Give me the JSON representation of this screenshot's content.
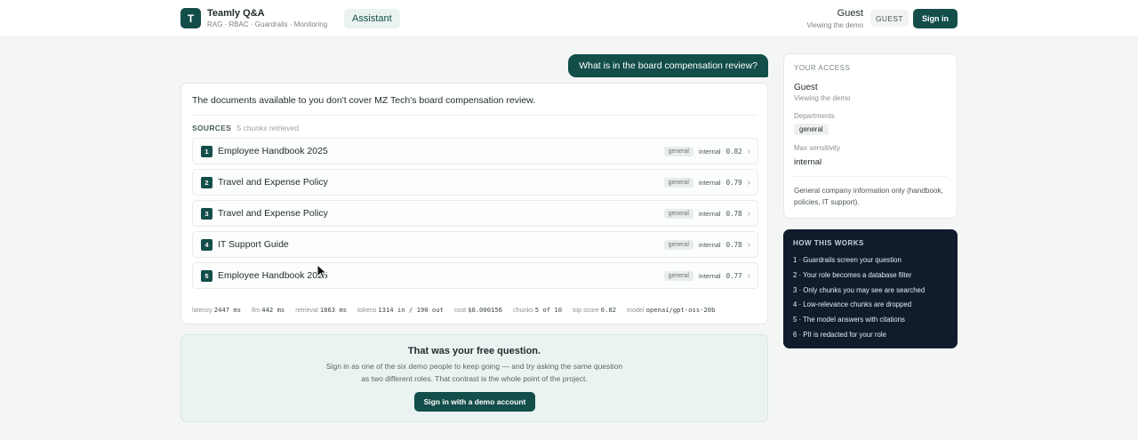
{
  "header": {
    "logo_letter": "T",
    "app_title": "Teamly Q&A",
    "app_subtitle": "RAG · RBAC · Guardrails · Monitoring",
    "nav_tab": "Assistant",
    "user_name": "Guest",
    "user_sub": "Viewing the demo",
    "role_badge": "GUEST",
    "signin_label": "Sign in"
  },
  "chat": {
    "question": "What is in the board compensation review?",
    "answer": "The documents available to you don't cover MZ Tech's board compensation review.",
    "sources_label": "SOURCES",
    "sources_count": "5 chunks retrieved",
    "sources": [
      {
        "num": "1",
        "title": "Employee Handbook 2025",
        "dept": "general",
        "sensitivity": "internal",
        "score": "0.82"
      },
      {
        "num": "2",
        "title": "Travel and Expense Policy",
        "dept": "general",
        "sensitivity": "internal",
        "score": "0.79"
      },
      {
        "num": "3",
        "title": "Travel and Expense Policy",
        "dept": "general",
        "sensitivity": "internal",
        "score": "0.78"
      },
      {
        "num": "4",
        "title": "IT Support Guide",
        "dept": "general",
        "sensitivity": "internal",
        "score": "0.78"
      },
      {
        "num": "5",
        "title": "Employee Handbook 2025",
        "dept": "general",
        "sensitivity": "internal",
        "score": "0.77"
      }
    ],
    "stats": {
      "latency_label": "latency",
      "latency": "2447 ms",
      "llm_label": "llm",
      "llm": "442 ms",
      "retrieval_label": "retrieval",
      "retrieval": "1863 ms",
      "tokens_label": "tokens",
      "tokens": "1314 in / 190 out",
      "cost_label": "cost",
      "cost": "$0.000156",
      "chunks_label": "chunks",
      "chunks": "5 of 10",
      "top_label": "top score",
      "top": "0.82",
      "model_label": "model",
      "model": "openai/gpt-oss-20b"
    }
  },
  "free": {
    "title": "That was your free question.",
    "body": "Sign in as one of the six demo people to keep going — and try asking the same question as two different roles. That contrast is the whole point of the project.",
    "button": "Sign in with a demo account"
  },
  "access": {
    "heading": "YOUR ACCESS",
    "name": "Guest",
    "sub": "Viewing the demo",
    "departments_label": "Departments",
    "department": "general",
    "sensitivity_label": "Max sensitivity",
    "sensitivity": "internal",
    "description": "General company information only (handbook, policies, IT support)."
  },
  "how": {
    "heading": "HOW THIS WORKS",
    "steps": [
      "1 · Guardrails screen your question",
      "2 · Your role becomes a database filter",
      "3 · Only chunks you may see are searched",
      "4 · Low-relevance chunks are dropped",
      "5 · The model answers with citations",
      "6 · PII is redacted for your role"
    ]
  },
  "colors": {
    "primary": "#134e4a",
    "dark_panel": "#101c2c",
    "background": "#f4f6f5"
  }
}
